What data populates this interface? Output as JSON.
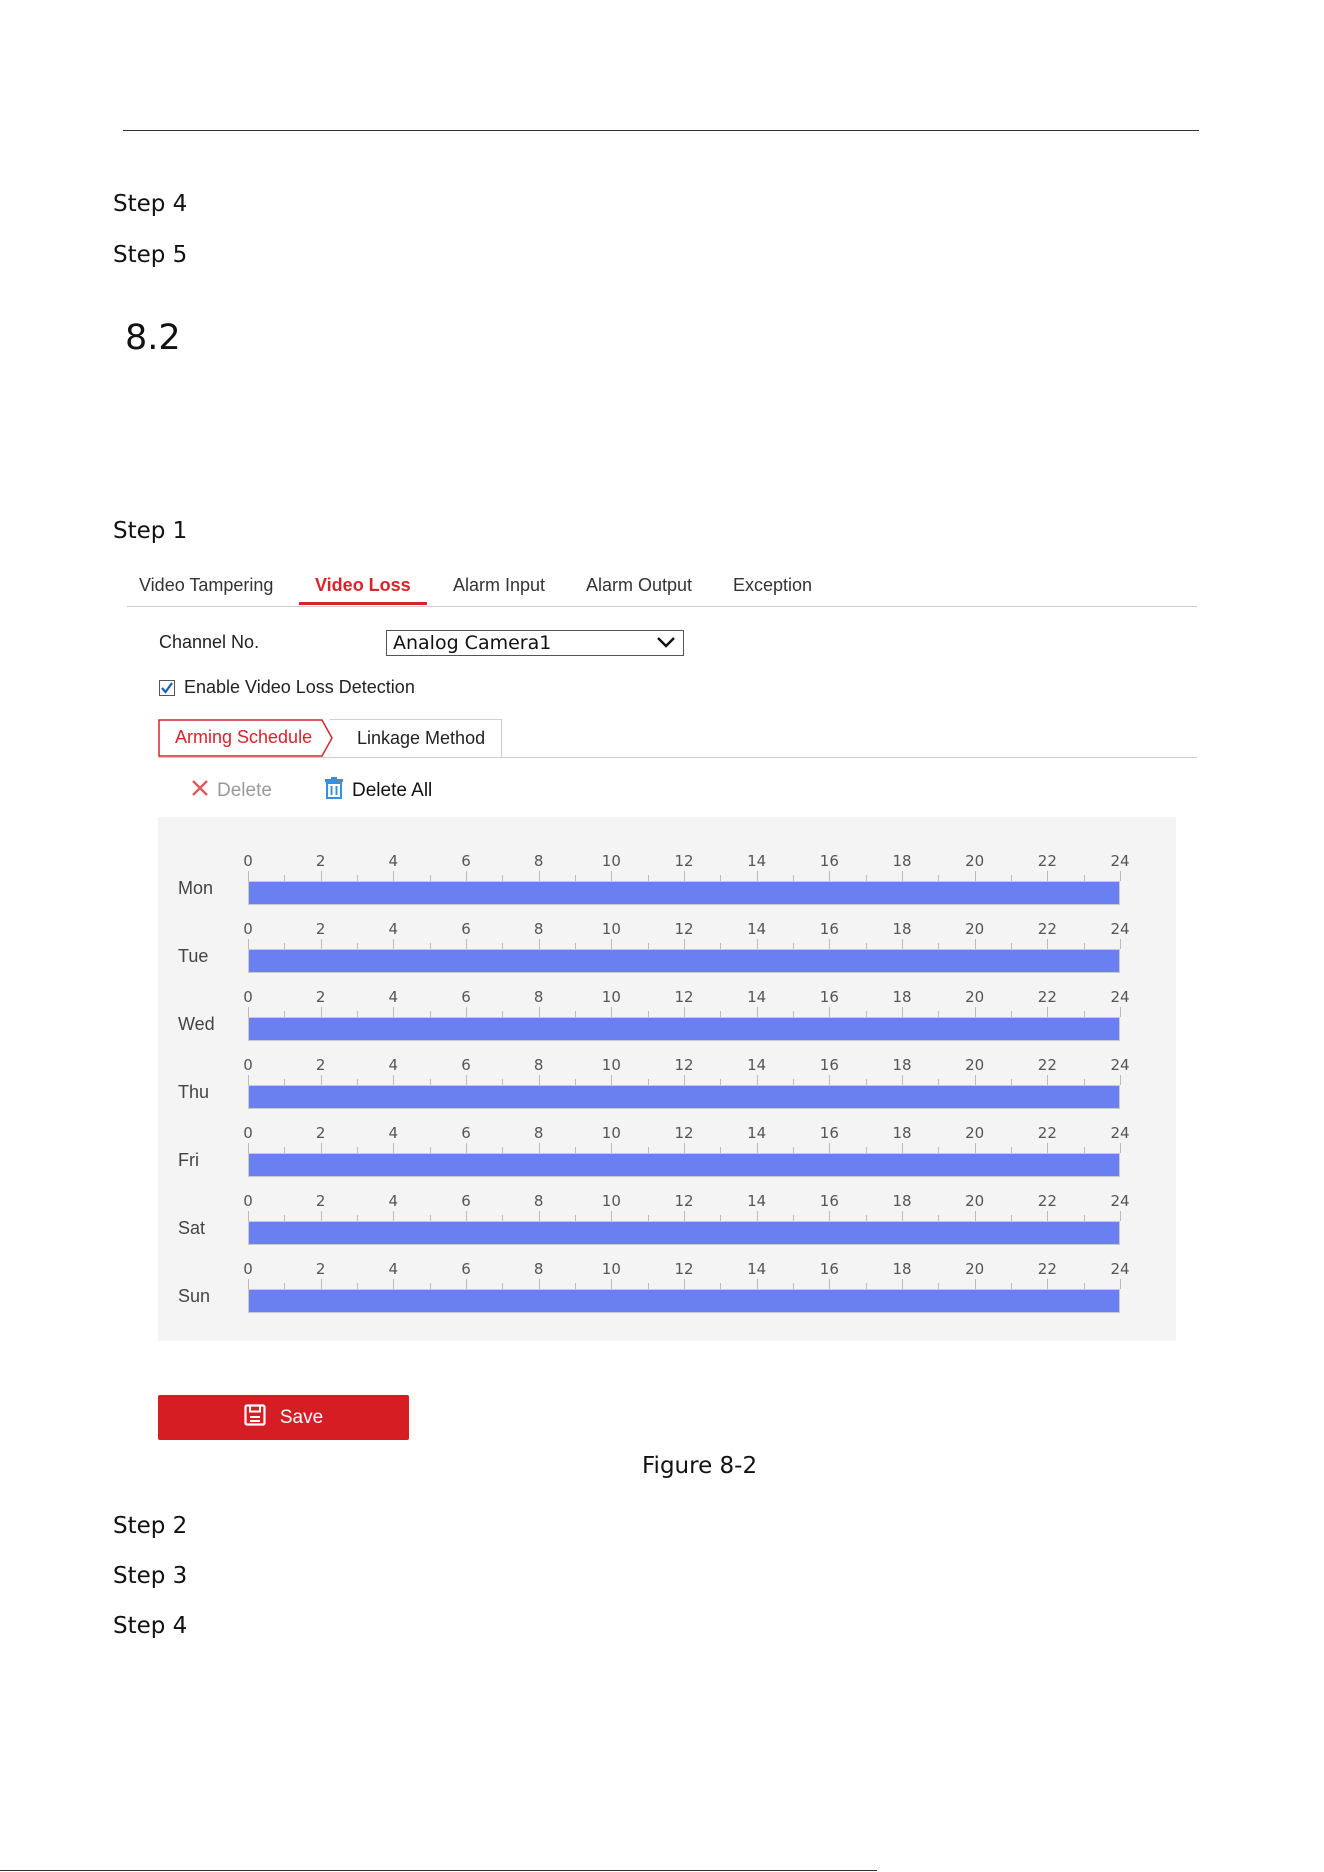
{
  "document": {
    "steps_top": [
      "Step 4",
      "Step 5"
    ],
    "section_number": "8.2",
    "step1": "Step 1",
    "steps_bottom": [
      "Step 2",
      "Step 3",
      "Step 4"
    ],
    "figure_caption": "Figure 8-2"
  },
  "ui": {
    "tabs": [
      "Video Tampering",
      "Video Loss",
      "Alarm Input",
      "Alarm Output",
      "Exception"
    ],
    "active_tab": "Video Loss",
    "channel_label": "Channel No.",
    "channel_value": "Analog Camera1",
    "enable_label": "Enable Video Loss Detection",
    "enable_checked": true,
    "subtabs": [
      "Arming Schedule",
      "Linkage Method"
    ],
    "delete_label": "Delete",
    "delete_all_label": "Delete All",
    "save_label": "Save",
    "accent_color": "#d8232a",
    "schedule_color": "#6a7ff0",
    "hour_labels": [
      "0",
      "2",
      "4",
      "6",
      "8",
      "10",
      "12",
      "14",
      "16",
      "18",
      "20",
      "22",
      "24"
    ],
    "days": [
      {
        "label": "Mon",
        "start": 0,
        "end": 24
      },
      {
        "label": "Tue",
        "start": 0,
        "end": 24
      },
      {
        "label": "Wed",
        "start": 0,
        "end": 24
      },
      {
        "label": "Thu",
        "start": 0,
        "end": 24
      },
      {
        "label": "Fri",
        "start": 0,
        "end": 24
      },
      {
        "label": "Sat",
        "start": 0,
        "end": 24
      },
      {
        "label": "Sun",
        "start": 0,
        "end": 24
      }
    ]
  }
}
